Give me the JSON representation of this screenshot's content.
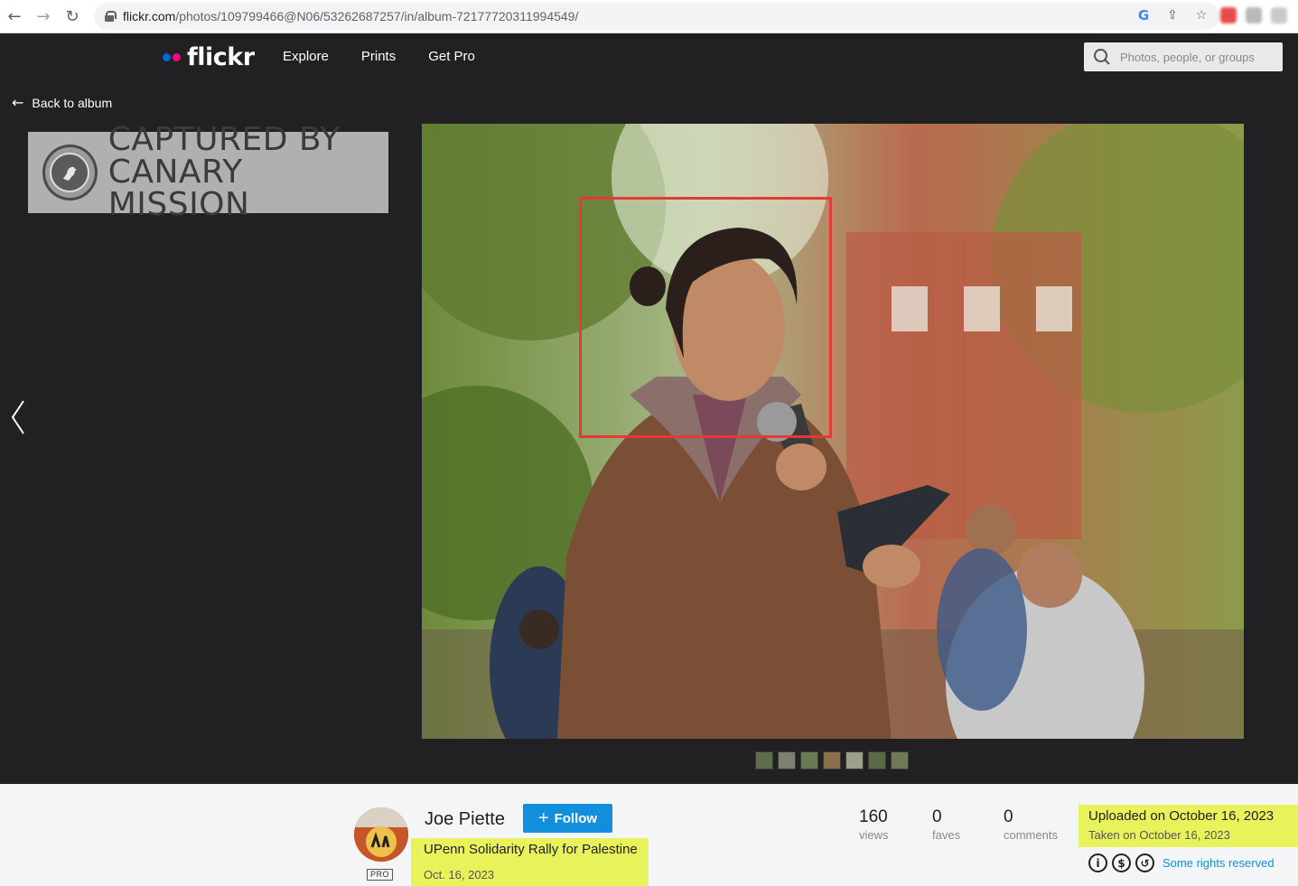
{
  "browser": {
    "url_domain": "flickr.com",
    "url_path": "/photos/109799466@N06/53262687257/in/album-72177720311994549/"
  },
  "header": {
    "logo": "flickr",
    "nav": [
      "Explore",
      "Prints",
      "Get Pro"
    ],
    "search_placeholder": "Photos, people, or groups"
  },
  "page": {
    "back_label": "Back to album",
    "watermark_lines": [
      "CAPTURED BY",
      "CANARY MISSION"
    ],
    "thumbnail_count": 7
  },
  "info": {
    "owner": "Joe Piette",
    "pro_badge": "PRO",
    "follow_label": "Follow",
    "title": "UPenn Solidarity Rally for Palestine",
    "date": "Oct. 16, 2023",
    "stats": [
      {
        "value": "160",
        "label": "views"
      },
      {
        "value": "0",
        "label": "faves"
      },
      {
        "value": "0",
        "label": "comments"
      }
    ],
    "uploaded": "Uploaded on October 16, 2023",
    "taken": "Taken on October 16, 2023",
    "rights": "Some rights reserved"
  },
  "colors": {
    "accent": "#128fdc",
    "highlight": "#e8f25a",
    "face_box": "#e53935"
  }
}
